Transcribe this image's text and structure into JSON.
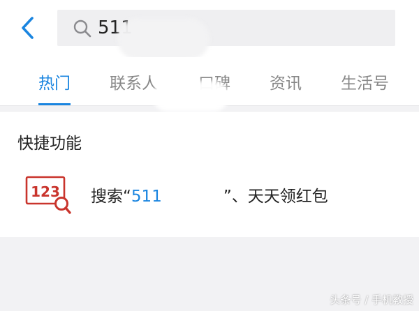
{
  "search": {
    "query": "511",
    "back_icon": "back-arrow-icon",
    "search_icon": "magnifier-icon",
    "clear_icon": "close-icon"
  },
  "tabs": [
    {
      "label": "热门",
      "active": true
    },
    {
      "label": "联系人",
      "active": false
    },
    {
      "label": "口碑",
      "active": false
    },
    {
      "label": "资讯",
      "active": false
    },
    {
      "label": "生活号",
      "active": false
    }
  ],
  "quick_functions": {
    "title": "快捷功能",
    "item": {
      "prefix": "搜索“",
      "query": "511",
      "suffix": "”、天天领红包",
      "icon": "number-search-icon",
      "icon_text": "123"
    }
  },
  "watermark": "头条号 / 手机教授",
  "colors": {
    "accent": "#1a85e0",
    "icon_red": "#c9342c",
    "background": "#f2f2f4"
  }
}
